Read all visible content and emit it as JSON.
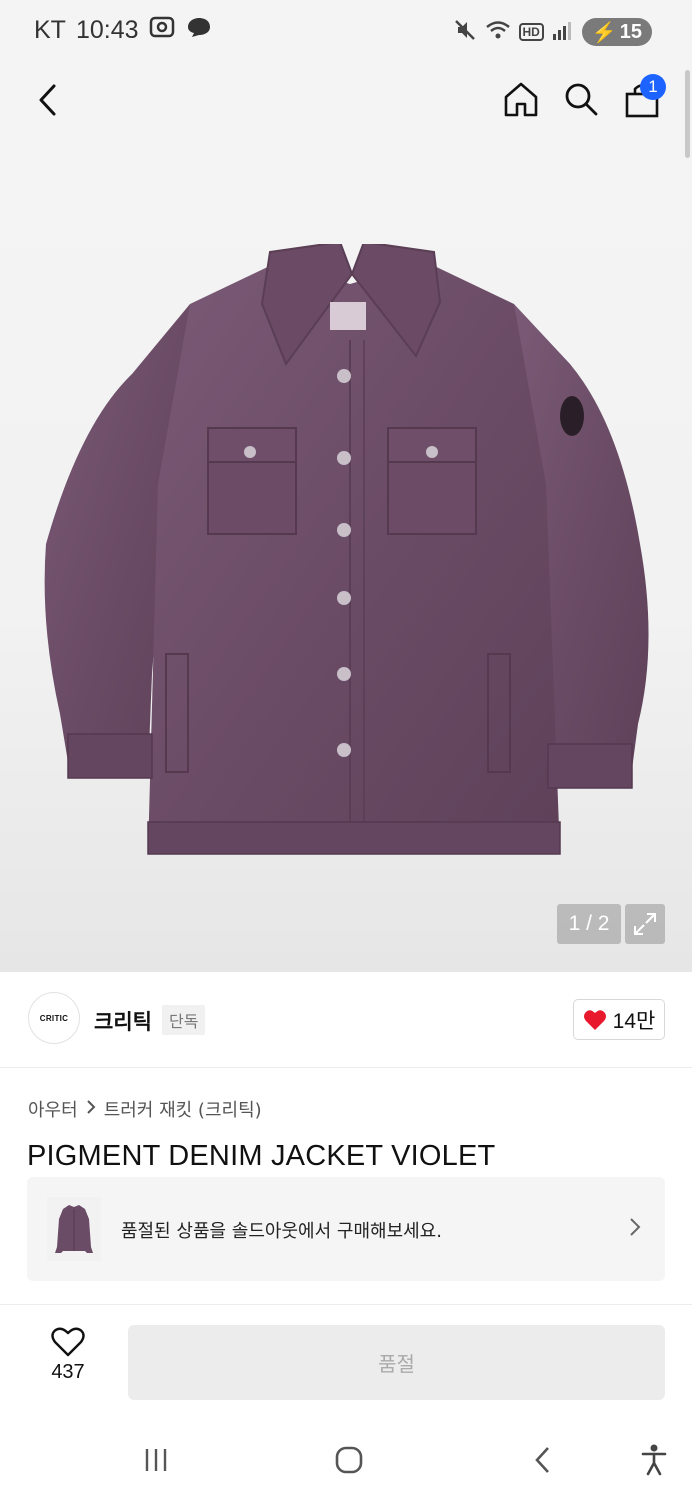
{
  "status_bar": {
    "carrier": "KT",
    "time": "10:43",
    "battery": "15",
    "network_badge": "HD"
  },
  "header": {
    "cart_count": "1",
    "icons": [
      "back-arrow-icon",
      "home-icon",
      "search-icon",
      "cart-icon"
    ]
  },
  "gallery": {
    "counter": "1 / 2",
    "product_color": "#6e4f6a"
  },
  "brand": {
    "logo_text": "CRITIC",
    "name": "크리틱",
    "tag": "단독",
    "likes": "14만"
  },
  "product": {
    "breadcrumb": [
      "아우터",
      "트러커 재킷 (크리틱)"
    ],
    "title": "PIGMENT DENIM JACKET VIOLET"
  },
  "soldout_banner": {
    "text": "품절된 상품을 솔드아웃에서 구매해보세요."
  },
  "bottom_bar": {
    "like_count": "437",
    "buy_label": "품절"
  },
  "colors": {
    "accent": "#1d63ff",
    "heart": "#e8192c",
    "disabled_button": "#ececec"
  }
}
